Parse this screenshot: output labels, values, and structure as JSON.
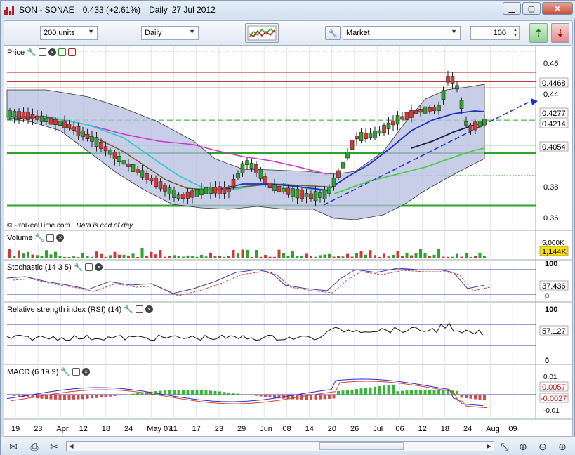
{
  "window": {
    "title": "SON - SONAE",
    "last": "0.433 (+2.61%)",
    "period": "Daily",
    "date": "27 Jul 2012",
    "buttons": [
      "minimize",
      "maximize",
      "close"
    ]
  },
  "toolbar": {
    "units_select": "200 units",
    "interval_select": "Daily",
    "order_type_select": "Market",
    "quantity": "100"
  },
  "price_panel": {
    "title": "Price",
    "watermark": "© ProRealTime.com",
    "note": "Data is end of day",
    "axis_labels": [
      "0.46",
      "0.44",
      "0.38",
      "0.36"
    ],
    "level_labels": [
      {
        "text": "0.4468",
        "bg": "#ffffff",
        "color": "#000000"
      },
      {
        "text": "0.4277",
        "bg": "#ffffff",
        "color": "#000000"
      },
      {
        "text": "0.4214",
        "bg": "#ffffff",
        "color": "#000000"
      },
      {
        "text": "0.4054",
        "bg": "#ffffff",
        "color": "#000000"
      }
    ]
  },
  "volume_panel": {
    "title": "Volume",
    "scale_label": "5,000K",
    "current_label": "1,144K",
    "current_bg": "#ffe000"
  },
  "stochastic_panel": {
    "title": "Stochastic (14 3 5)",
    "axis_labels": [
      "100",
      "0"
    ],
    "current_label": "37.436"
  },
  "rsi_panel": {
    "title": "Relative strength index (RSI) (14)",
    "axis_labels": [
      "100",
      "0"
    ],
    "current_label": "57.127"
  },
  "macd_panel": {
    "title": "MACD (6 19 9)",
    "axis_labels": [
      "0.01",
      "-0.01"
    ],
    "current_label_1": "0.0057",
    "current_label_2": "-0.0027"
  },
  "x_axis": {
    "labels": [
      "19",
      "23",
      "Apr",
      "12",
      "18",
      "24",
      "May 07",
      "11",
      "17",
      "23",
      "29",
      "Jun",
      "08",
      "14",
      "20",
      "26",
      "Jul",
      "06",
      "12",
      "18",
      "24",
      "Aug",
      "09"
    ]
  },
  "colors": {
    "band": "#b7bde0",
    "up_candle": "#2ea42e",
    "down_candle": "#d23a3a",
    "ma_magenta": "#cc33cc",
    "ma_cyan": "#33cccc",
    "ma_blue": "#1a2ecc",
    "ma_brown": "#6b5a22",
    "green_line": "#2aa52a",
    "red_line": "#c0161a"
  },
  "bottombar": {
    "icons": [
      "email-icon",
      "print-icon",
      "settings-icon",
      "zoom-fit-icon",
      "zoom-out-icon",
      "zoom-in-icon"
    ]
  }
}
